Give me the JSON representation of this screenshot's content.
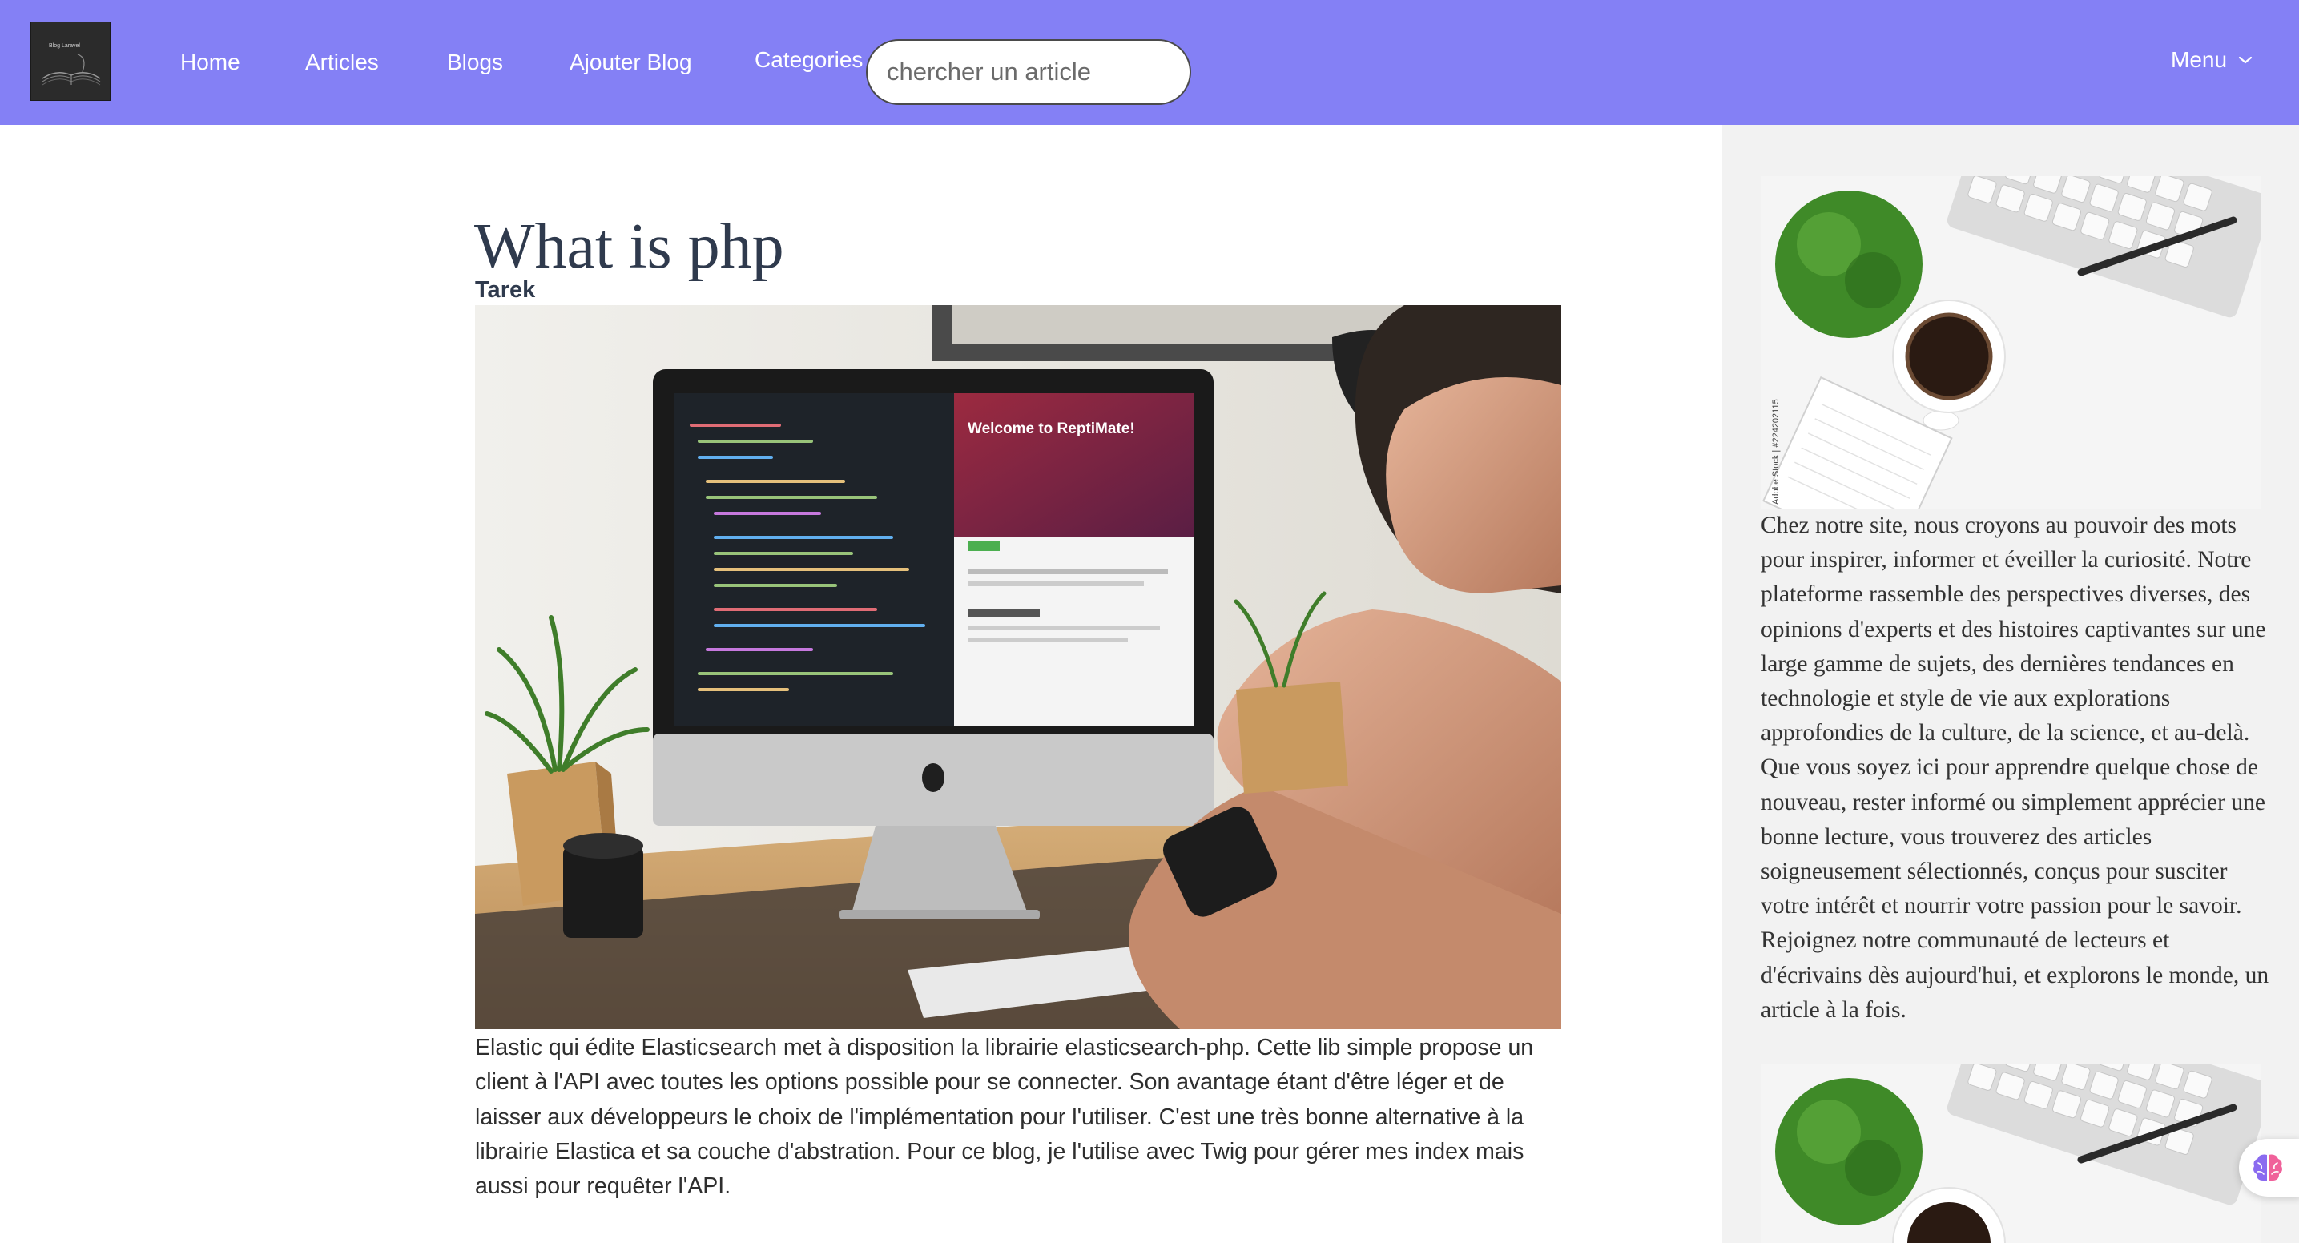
{
  "navbar": {
    "logo_icon": "book-logo",
    "logo_caption": "Blog Laravel",
    "links": [
      {
        "label": "Home"
      },
      {
        "label": "Articles"
      },
      {
        "label": "Blogs"
      },
      {
        "label": "Ajouter Blog"
      },
      {
        "label": "Categories"
      }
    ],
    "search": {
      "placeholder": "chercher un article",
      "value": ""
    },
    "menu": {
      "label": "Menu",
      "icon": "chevron-down-icon"
    }
  },
  "article": {
    "title": "What is php",
    "author": "Tarek",
    "image_icon": "developer-desk-photo",
    "monitor_heading": "Welcome to ReptiMate!",
    "body": "Elastic qui édite Elasticsearch met à disposition la librairie elasticsearch-php. Cette lib simple propose un client à l'API avec toutes les options possible pour se connecter. Son avantage étant d'être léger et de laisser aux développeurs le choix de l'implémentation pour l'utiliser. C'est une très bonne alternative à la librairie Elastica et sa couche d'abstration. Pour ce blog, je l'utilise avec Twig pour gérer mes index mais aussi pour requêter l'API."
  },
  "sidebar": {
    "image_icon": "desk-flatlay-photo",
    "image_watermark": "Adobe Stock | #224202115",
    "text": "Chez notre site, nous croyons au pouvoir des mots pour inspirer, informer et éveiller la curiosité. Notre plateforme rassemble des perspectives diverses, des opinions d'experts et des histoires captivantes sur une large gamme de sujets, des dernières tendances en technologie et style de vie aux explorations approfondies de la culture, de la science, et au-delà. Que vous soyez ici pour apprendre quelque chose de nouveau, rester informé ou simplement apprécier une bonne lecture, vous trouverez des articles soigneusement sélectionnés, conçus pour susciter votre intérêt et nourrir votre passion pour le savoir. Rejoignez notre communauté de lecteurs et d'écrivains dès aujourd'hui, et explorons le monde, un article à la fois."
  },
  "assistant": {
    "icon": "brain-icon"
  },
  "colors": {
    "navbar_bg": "#8480f5",
    "sidebar_bg": "#f2f2f2",
    "title_text": "#2f3a4d"
  }
}
